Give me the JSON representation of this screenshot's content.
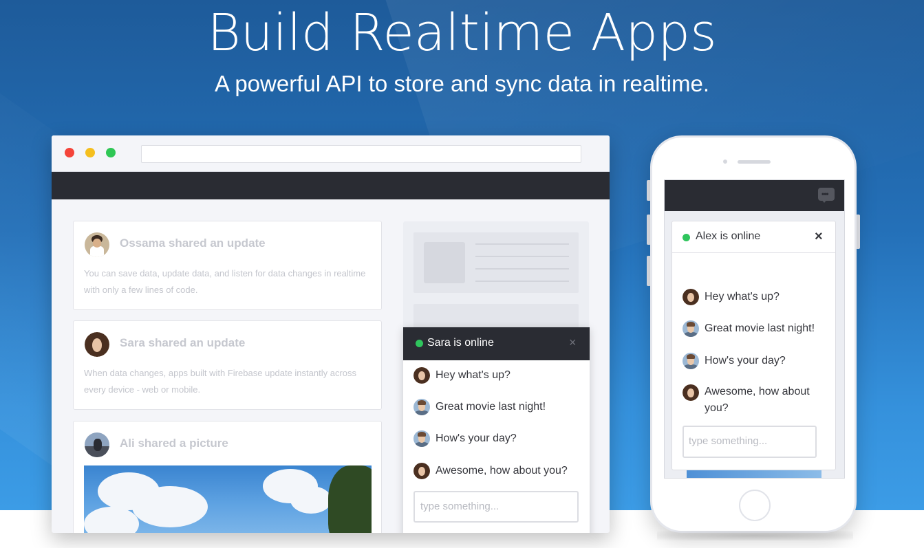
{
  "hero": {
    "title": "Build Realtime Apps",
    "subtitle": "A powerful API to store and sync data in realtime."
  },
  "browser": {
    "feed": [
      {
        "title": "Ossama shared an update",
        "text": "You can save data, update data, and listen for data changes in realtime with only a few lines of code.",
        "avatar": "ossama-avatar"
      },
      {
        "title": "Sara shared an update",
        "text": "When data changes, apps built with Firebase update instantly across every device - web or mobile.",
        "avatar": "sara-avatar"
      },
      {
        "title": "Ali shared a picture",
        "avatar": "ali-avatar"
      }
    ],
    "chat": {
      "status": "Sara is online",
      "close": "×",
      "messages": [
        {
          "text": "Hey what's up?",
          "avatar": "woman"
        },
        {
          "text": "Great movie last night!",
          "avatar": "man"
        },
        {
          "text": "How's your day?",
          "avatar": "man"
        },
        {
          "text": "Awesome, how about you?",
          "avatar": "woman"
        }
      ],
      "input_placeholder": "type something..."
    }
  },
  "phone": {
    "chat": {
      "status": "Alex is online",
      "close": "×",
      "messages": [
        {
          "text": "Hey what's up?",
          "avatar": "woman"
        },
        {
          "text": "Great movie last night!",
          "avatar": "man"
        },
        {
          "text": "How's your day?",
          "avatar": "man"
        },
        {
          "text1": "Awesome, how about",
          "text2": "you?",
          "avatar": "woman"
        }
      ],
      "input_placeholder": "type something..."
    }
  },
  "colors": {
    "online": "#2fc55d",
    "dark_bar": "#2a2c33",
    "hero_blue": "#2470b8"
  }
}
